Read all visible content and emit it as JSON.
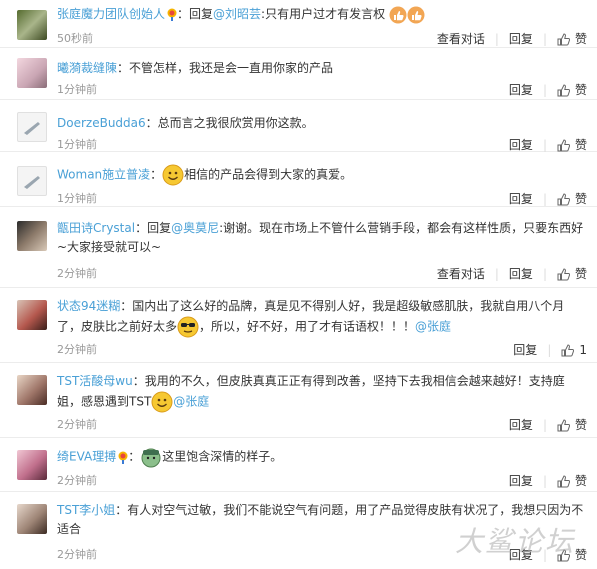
{
  "actions": {
    "view_dialog": "查看对话",
    "reply": "回复",
    "like": "赞"
  },
  "comments": [
    {
      "name": "张庭魔力团队创始人",
      "reply_prefix": "：回复",
      "reply_to": "@刘昭芸",
      "text": ":只有用户过才有发言权",
      "time": "50秒前",
      "like": "赞"
    },
    {
      "name": "曦漪裁缝陳",
      "text": "：不管怎样，我还是会一直用你家的产品",
      "time": "1分钟前",
      "like": "赞"
    },
    {
      "name": "DoerzeBudda6",
      "text": "：总而言之我很欣赏用你这款。",
      "time": "1分钟前",
      "like": "赞"
    },
    {
      "name": "Woman施立普凌",
      "text_pre": "：",
      "text": "相信的产品会得到大家的真爱。",
      "time": "1分钟前",
      "like": "赞"
    },
    {
      "name": "甑田诗Crystal",
      "reply_prefix": "：回复",
      "reply_to": "@奥莫尼",
      "text": ":谢谢。现在市场上不管什么营销手段，都会有这样性质，只要东西好~大家接受就可以~",
      "time": "2分钟前",
      "like": "赞"
    },
    {
      "name": "状态94迷糊",
      "text1": "：国内出了这么好的品牌，真是见不得别人好，我是超级敏感肌肤，我就自用八个月了，皮肤比之前好太多",
      "text2": "，所以，好不好，用了才有话语权！！！",
      "mention": "@张庭",
      "time": "2分钟前",
      "like": "1"
    },
    {
      "name": "TST活酸母wu",
      "text1": "：我用的不久，但皮肤真真正正有得到改善，坚持下去我相信会越来越好！支持庭姐，感恩遇到TST",
      "mention": "@张庭",
      "time": "2分钟前",
      "like": "赞"
    },
    {
      "name": "绮EVA理搏",
      "text": "这里饱含深情的样子。",
      "time": "2分钟前",
      "like": "赞"
    },
    {
      "name": "TST李小姐",
      "text": "：有人对空气过敏，我们不能说空气有问题，用了产品觉得皮肤有状况了，我想只因为不适合",
      "time": "2分钟前",
      "like": "赞"
    }
  ],
  "watermark": "大鲨论坛",
  "colors": {
    "link": "#4aa0d6",
    "time": "#999999",
    "text": "#333333"
  },
  "icons": [
    "thumbs-up-icon",
    "smiley-icon",
    "sunglasses-emoji-icon",
    "vip-badge-icon"
  ]
}
